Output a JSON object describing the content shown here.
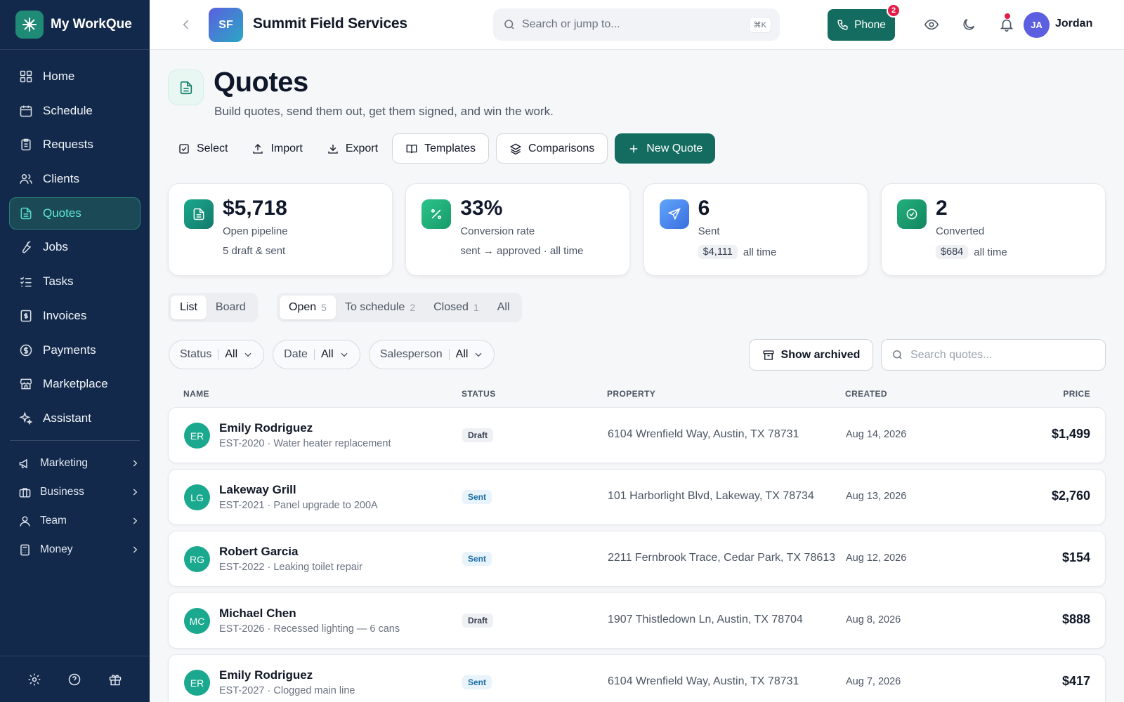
{
  "app": {
    "name": "My WorkQue"
  },
  "sidebar": {
    "items": [
      {
        "label": "Home",
        "icon": "grid-icon"
      },
      {
        "label": "Schedule",
        "icon": "calendar-icon"
      },
      {
        "label": "Requests",
        "icon": "clipboard-icon"
      },
      {
        "label": "Clients",
        "icon": "users-icon"
      },
      {
        "label": "Quotes",
        "icon": "file-text-icon",
        "active": true
      },
      {
        "label": "Jobs",
        "icon": "wrench-icon"
      },
      {
        "label": "Tasks",
        "icon": "checklist-icon"
      },
      {
        "label": "Invoices",
        "icon": "receipt-icon"
      },
      {
        "label": "Payments",
        "icon": "dollar-circle-icon"
      },
      {
        "label": "Marketplace",
        "icon": "store-icon"
      },
      {
        "label": "Assistant",
        "icon": "sparkles-icon"
      }
    ],
    "groups": [
      {
        "label": "Marketing",
        "icon": "megaphone-icon"
      },
      {
        "label": "Business",
        "icon": "briefcase-icon"
      },
      {
        "label": "Team",
        "icon": "user-icon"
      },
      {
        "label": "Money",
        "icon": "calculator-icon"
      }
    ],
    "bottom_icons": [
      "settings-icon",
      "help-icon",
      "gift-icon"
    ]
  },
  "topbar": {
    "company_initials": "SF",
    "company_name": "Summit Field Services",
    "search_placeholder": "Search or jump to...",
    "shortcut": "⌘K",
    "phone_label": "Phone",
    "phone_badge": "2",
    "user_initials": "JA",
    "user_name": "Jordan"
  },
  "page": {
    "title": "Quotes",
    "subtitle": "Build quotes, send them out, get them signed, and win the work."
  },
  "actions": {
    "select": "Select",
    "import": "Import",
    "export": "Export",
    "templates": "Templates",
    "comparisons": "Comparisons",
    "new_quote": "New Quote"
  },
  "kpis": [
    {
      "value": "$5,718",
      "label": "Open pipeline",
      "sub": "5 draft & sent",
      "color": "#1a9a82"
    },
    {
      "value": "33%",
      "label": "Conversion rate",
      "sub": "sent → approved · all time",
      "color": "#22b07d"
    },
    {
      "value": "6",
      "label": "Sent",
      "pill": "$4,111",
      "sub": "all time",
      "color": "#3b82f6"
    },
    {
      "value": "2",
      "label": "Converted",
      "pill": "$684",
      "sub": "all time",
      "color": "#17a673"
    }
  ],
  "views": {
    "layout": [
      {
        "label": "List",
        "active": true
      },
      {
        "label": "Board"
      }
    ],
    "tabs": [
      {
        "label": "Open",
        "count": "5",
        "active": true
      },
      {
        "label": "To schedule",
        "count": "2"
      },
      {
        "label": "Closed",
        "count": "1"
      },
      {
        "label": "All",
        "count": ""
      }
    ]
  },
  "filters": [
    {
      "label": "Status",
      "value": "All"
    },
    {
      "label": "Date",
      "value": "All"
    },
    {
      "label": "Salesperson",
      "value": "All"
    }
  ],
  "show_archived": "Show archived",
  "quote_search_placeholder": "Search quotes...",
  "table": {
    "columns": [
      "NAME",
      "STATUS",
      "PROPERTY",
      "CREATED",
      "PRICE"
    ],
    "rows": [
      {
        "initials": "ER",
        "name": "Emily Rodriguez",
        "desc": "EST-2020 · Water heater replacement",
        "status": "Draft",
        "property": "6104 Wrenfield Way, Austin, TX 78731",
        "created": "Aug 14, 2026",
        "price": "$1,499"
      },
      {
        "initials": "LG",
        "name": "Lakeway Grill",
        "desc": "EST-2021 · Panel upgrade to 200A",
        "status": "Sent",
        "property": "101 Harborlight Blvd, Lakeway, TX 78734",
        "created": "Aug 13, 2026",
        "price": "$2,760"
      },
      {
        "initials": "RG",
        "name": "Robert Garcia",
        "desc": "EST-2022 · Leaking toilet repair",
        "status": "Sent",
        "property": "2211 Fernbrook Trace, Cedar Park, TX 78613",
        "created": "Aug 12, 2026",
        "price": "$154"
      },
      {
        "initials": "MC",
        "name": "Michael Chen",
        "desc": "EST-2026 · Recessed lighting — 6 cans",
        "status": "Draft",
        "property": "1907 Thistledown Ln, Austin, TX 78704",
        "created": "Aug 8, 2026",
        "price": "$888"
      },
      {
        "initials": "ER",
        "name": "Emily Rodriguez",
        "desc": "EST-2027 · Clogged main line",
        "status": "Sent",
        "property": "6104 Wrenfield Way, Austin, TX 78731",
        "created": "Aug 7, 2026",
        "price": "$417"
      }
    ]
  }
}
